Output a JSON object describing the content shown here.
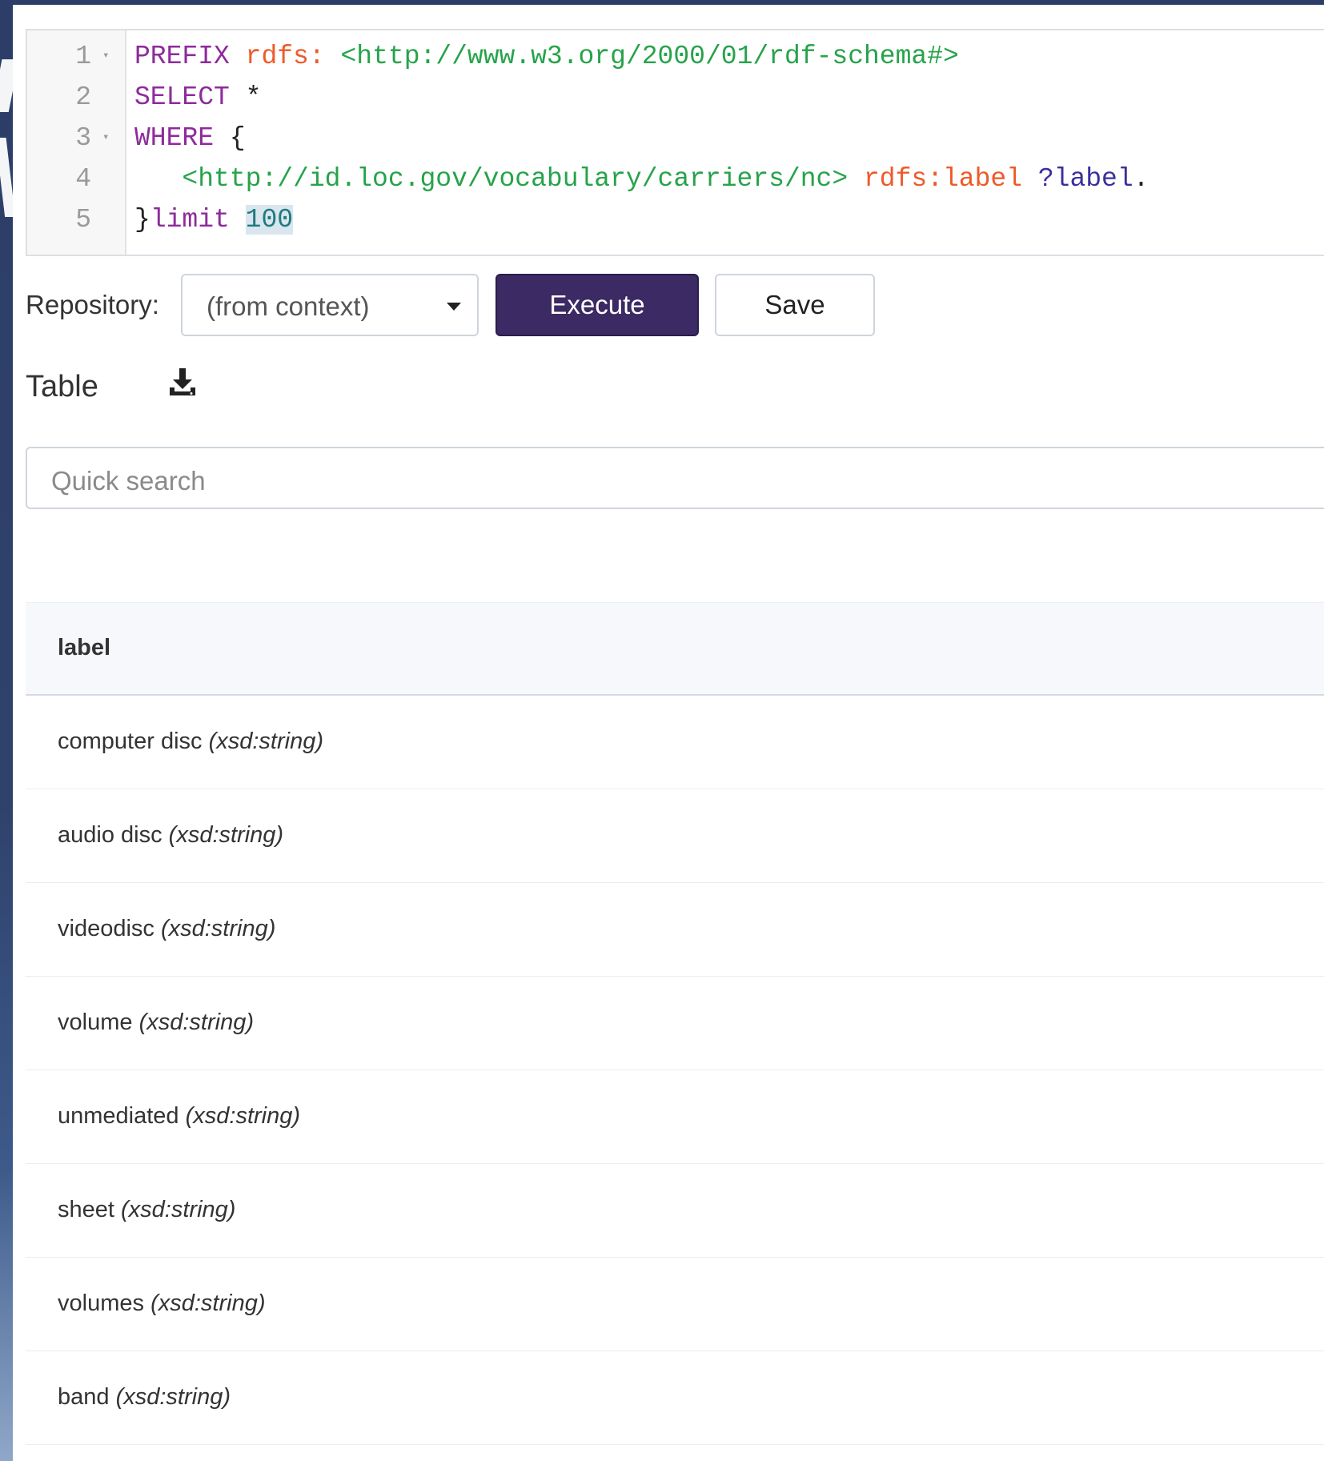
{
  "editor": {
    "lines": [
      {
        "number": "1",
        "foldable": true,
        "tokens": [
          {
            "t": "PREFIX",
            "c": "kw"
          },
          {
            "t": " ",
            "c": "op"
          },
          {
            "t": "rdfs:",
            "c": "pfx"
          },
          {
            "t": " ",
            "c": "op"
          },
          {
            "t": "<http://www.w3.org/2000/01/rdf-schema#>",
            "c": "uri"
          }
        ]
      },
      {
        "number": "2",
        "foldable": false,
        "tokens": [
          {
            "t": "SELECT",
            "c": "kw"
          },
          {
            "t": " *",
            "c": "op"
          }
        ]
      },
      {
        "number": "3",
        "foldable": true,
        "tokens": [
          {
            "t": "WHERE",
            "c": "kw"
          },
          {
            "t": " {",
            "c": "op"
          }
        ]
      },
      {
        "number": "4",
        "foldable": false,
        "tokens": [
          {
            "t": "   ",
            "c": "op"
          },
          {
            "t": "<http://id.loc.gov/vocabulary/carriers/nc>",
            "c": "uri"
          },
          {
            "t": " ",
            "c": "op"
          },
          {
            "t": "rdfs:label",
            "c": "pfx"
          },
          {
            "t": " ",
            "c": "op"
          },
          {
            "t": "?label",
            "c": "var"
          },
          {
            "t": ".",
            "c": "op"
          }
        ]
      },
      {
        "number": "5",
        "foldable": false,
        "tokens": [
          {
            "t": "}",
            "c": "op"
          },
          {
            "t": "limit",
            "c": "kw"
          },
          {
            "t": " ",
            "c": "op"
          },
          {
            "t": "100",
            "c": "num-hl"
          }
        ]
      }
    ]
  },
  "toolbar": {
    "repository_label": "Repository:",
    "repository_value": "(from context)",
    "execute_label": "Execute",
    "save_label": "Save"
  },
  "results": {
    "view_label": "Table",
    "download_icon": "download-icon",
    "search_placeholder": "Quick search",
    "column_header": "label",
    "rows": [
      {
        "value": "computer disc",
        "datatype": "(xsd:string)"
      },
      {
        "value": "audio disc",
        "datatype": "(xsd:string)"
      },
      {
        "value": "videodisc",
        "datatype": "(xsd:string)"
      },
      {
        "value": "volume",
        "datatype": "(xsd:string)"
      },
      {
        "value": "unmediated",
        "datatype": "(xsd:string)"
      },
      {
        "value": "sheet",
        "datatype": "(xsd:string)"
      },
      {
        "value": "volumes",
        "datatype": "(xsd:string)"
      },
      {
        "value": "band",
        "datatype": "(xsd:string)"
      }
    ]
  },
  "colors": {
    "keyword": "#8e2b9c",
    "prefix": "#ee5a29",
    "uri": "#26a34a",
    "variable": "#3a2f9e",
    "execute_button": "#3b2a63"
  }
}
